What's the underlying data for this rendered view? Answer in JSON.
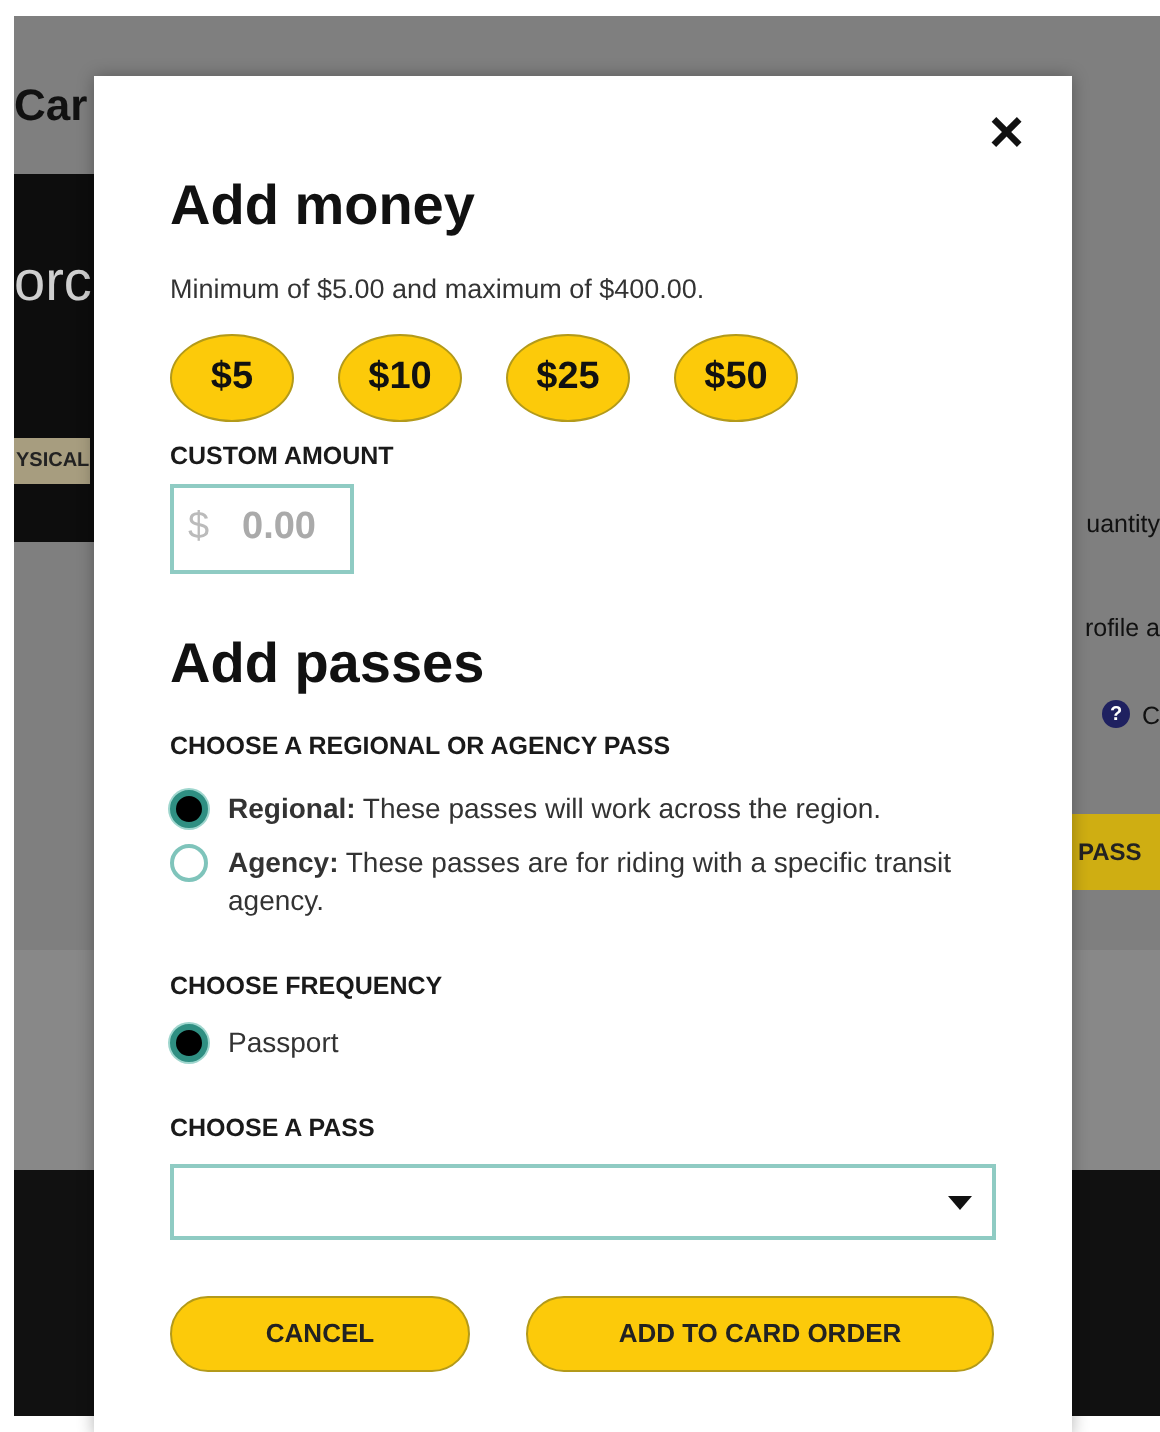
{
  "background": {
    "title": "Car",
    "logo": "orc",
    "badge": "YSICAL",
    "quantity": "uantity",
    "profile": "rofile a",
    "help_mark": "?",
    "help_text": "C",
    "button": "PASS"
  },
  "modal": {
    "close": "×",
    "money": {
      "title": "Add money",
      "note": "Minimum of $5.00 and maximum of $400.00.",
      "amounts": [
        "$5",
        "$10",
        "$25",
        "$50"
      ],
      "custom": {
        "label": "CUSTOM AMOUNT",
        "prefix": "$",
        "placeholder": "0.00"
      }
    },
    "passes": {
      "title": "Add passes",
      "type": {
        "label": "CHOOSE A REGIONAL OR AGENCY PASS",
        "options": [
          {
            "text": "**Regional:** These passes will work across the region.",
            "selected": true
          },
          {
            "text": "**Agency:** These passes are for riding with a specific transit agency.",
            "selected": false
          }
        ]
      },
      "frequency": {
        "label": "CHOOSE FREQUENCY",
        "options": [
          {
            "text": "Passport",
            "selected": true
          }
        ]
      },
      "pass": {
        "label": "CHOOSE A PASS"
      }
    },
    "buttons": [
      {
        "label": "CANCEL"
      },
      {
        "label": "ADD TO CARD ORDER"
      }
    ]
  }
}
